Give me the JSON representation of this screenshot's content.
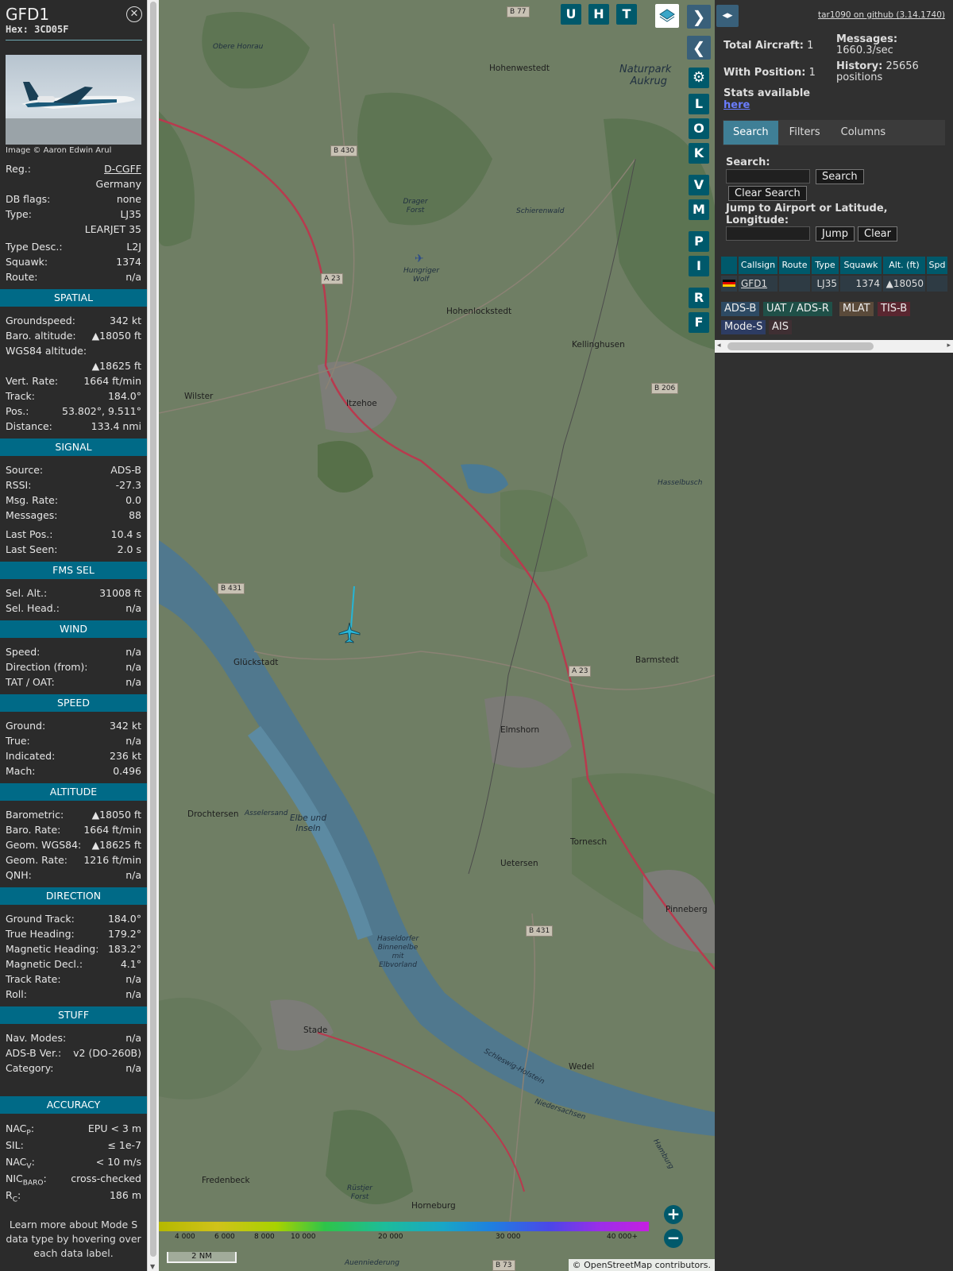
{
  "sidebar": {
    "callsign": "GFD1",
    "hex": "Hex: 3CD05F",
    "photo_credit": "Image © Aaron Edwin Arul",
    "info": [
      {
        "label": "Reg.:",
        "value": "D-CGFF"
      },
      {
        "label": "",
        "value": "Germany"
      },
      {
        "label": "DB flags:",
        "value": "none"
      },
      {
        "label": "Type:",
        "value": "LJ35"
      },
      {
        "label": "",
        "value": "LEARJET 35"
      }
    ],
    "info2": [
      {
        "label": "Type Desc.:",
        "value": "L2J"
      },
      {
        "label": "Squawk:",
        "value": "1374"
      },
      {
        "label": "Route:",
        "value": "n/a"
      }
    ],
    "spatial_title": "SPATIAL",
    "spatial": [
      {
        "label": "Groundspeed:",
        "value": "342 kt"
      },
      {
        "label": "Baro. altitude:",
        "value": "▲18050 ft"
      },
      {
        "label": "WGS84 altitude:",
        "value": ""
      },
      {
        "label": "",
        "value": "▲18625 ft"
      },
      {
        "label": "Vert. Rate:",
        "value": "1664 ft/min"
      },
      {
        "label": "Track:",
        "value": "184.0°"
      },
      {
        "label": "Pos.:",
        "value": "53.802°, 9.511°"
      },
      {
        "label": "Distance:",
        "value": "133.4 nmi"
      }
    ],
    "signal_title": "SIGNAL",
    "signal": [
      {
        "label": "Source:",
        "value": "ADS-B"
      },
      {
        "label": "RSSI:",
        "value": "-27.3"
      },
      {
        "label": "Msg. Rate:",
        "value": "0.0"
      },
      {
        "label": "Messages:",
        "value": "88"
      }
    ],
    "signal2": [
      {
        "label": "Last Pos.:",
        "value": "10.4 s"
      },
      {
        "label": "Last Seen:",
        "value": "2.0 s"
      }
    ],
    "fms_title": "FMS SEL",
    "fms": [
      {
        "label": "Sel. Alt.:",
        "value": "31008 ft"
      },
      {
        "label": "Sel. Head.:",
        "value": "n/a"
      }
    ],
    "wind_title": "WIND",
    "wind": [
      {
        "label": "Speed:",
        "value": "n/a"
      },
      {
        "label": "Direction (from):",
        "value": "n/a"
      },
      {
        "label": "TAT / OAT:",
        "value": "n/a"
      }
    ],
    "speed_title": "SPEED",
    "speed": [
      {
        "label": "Ground:",
        "value": "342 kt"
      },
      {
        "label": "True:",
        "value": "n/a"
      },
      {
        "label": "Indicated:",
        "value": "236 kt"
      },
      {
        "label": "Mach:",
        "value": "0.496"
      }
    ],
    "altitude_title": "ALTITUDE",
    "altitude": [
      {
        "label": "Barometric:",
        "value": "▲18050 ft"
      },
      {
        "label": "Baro. Rate:",
        "value": "1664 ft/min"
      },
      {
        "label": "Geom. WGS84:",
        "value": "▲18625 ft"
      },
      {
        "label": "Geom. Rate:",
        "value": "1216 ft/min"
      },
      {
        "label": "QNH:",
        "value": "n/a"
      }
    ],
    "direction_title": "DIRECTION",
    "direction": [
      {
        "label": "Ground Track:",
        "value": "184.0°"
      },
      {
        "label": "True Heading:",
        "value": "179.2°"
      },
      {
        "label": "Magnetic Heading:",
        "value": "183.2°"
      },
      {
        "label": "Magnetic Decl.:",
        "value": "4.1°"
      },
      {
        "label": "Track Rate:",
        "value": "n/a"
      },
      {
        "label": "Roll:",
        "value": "n/a"
      }
    ],
    "stuff_title": "STUFF",
    "stuff": [
      {
        "label": "Nav. Modes:",
        "value": "n/a"
      },
      {
        "label": "ADS-B Ver.:",
        "value": "v2 (DO-260B)"
      },
      {
        "label": "Category:",
        "value": "n/a"
      }
    ],
    "accuracy_title": "ACCURACY",
    "accuracy": [
      {
        "label": "NAC",
        "sub": "P",
        "value": "EPU < 3 m"
      },
      {
        "label": "SIL:",
        "sub": "",
        "value": "≤ 1e-7"
      },
      {
        "label": "NAC",
        "sub": "V",
        "value": "< 10 m/s"
      },
      {
        "label": "NIC",
        "sub": "BARO",
        "value": "cross-checked"
      },
      {
        "label": "R",
        "sub": "C",
        "value": "186 m"
      }
    ],
    "learn_more": "Learn more about Mode S data type by hovering over each data label."
  },
  "map": {
    "labels": [
      {
        "t": "Obere Honrau"
      },
      {
        "t": "Hohenwestedt"
      },
      {
        "t": "Naturpark Aukrug"
      },
      {
        "t": "Drager Forst"
      },
      {
        "t": "Schierenwald"
      },
      {
        "t": "Hungriger Wolf"
      },
      {
        "t": "Hohenlockstedt"
      },
      {
        "t": "Kellinghusen"
      },
      {
        "t": "Wilster"
      },
      {
        "t": "Itzehoe"
      },
      {
        "t": "Hasselbusch"
      },
      {
        "t": "Glückstadt"
      },
      {
        "t": "Barmstedt"
      },
      {
        "t": "Elmshorn"
      },
      {
        "t": "Drochtersen"
      },
      {
        "t": "Asselersand"
      },
      {
        "t": "Elbe und Inseln"
      },
      {
        "t": "Tornesch"
      },
      {
        "t": "Uetersen"
      },
      {
        "t": "Pinneberg"
      },
      {
        "t": "Haseldorfer Binnenelbe mit Elbvorland"
      },
      {
        "t": "Stade"
      },
      {
        "t": "Wedel"
      },
      {
        "t": "Schleswig-Holstein"
      },
      {
        "t": "Niedersachsen"
      },
      {
        "t": "Fredenbeck"
      },
      {
        "t": "Rüstjer Forst"
      },
      {
        "t": "Horneburg"
      },
      {
        "t": "Auenniederung"
      },
      {
        "t": "Hamburg"
      }
    ],
    "roads": [
      "B 77",
      "B 430",
      "A 23",
      "B 206",
      "B 431",
      "A 23",
      "B 431",
      "B 73"
    ],
    "controls_top": [
      "U",
      "H",
      "T"
    ],
    "controls_side": [
      "L",
      "O",
      "K",
      "V",
      "M",
      "P",
      "I",
      "R",
      "F"
    ],
    "color_ticks": [
      "4 000",
      "6 000",
      "8 000",
      "10 000",
      "20 000",
      "30 000",
      "40 000+"
    ],
    "scale": "2 NM",
    "attribution": "© OpenStreetMap contributors."
  },
  "panel": {
    "github": "tar1090 on github (3.14.1740)",
    "total_aircraft_label": "Total Aircraft:",
    "total_aircraft": "1",
    "with_position_label": "With Position:",
    "with_position": "1",
    "stats_label": "Stats available",
    "stats_link": "here",
    "messages_label": "Messages:",
    "messages_rate": "1660.3/sec",
    "history_label": "History:",
    "history_value": "25656",
    "history_unit": "positions",
    "tabs": [
      "Search",
      "Filters",
      "Columns"
    ],
    "search_label": "Search:",
    "search_button": "Search",
    "clear_search_button": "Clear Search",
    "jump_label": "Jump to Airport or Latitude, Longitude:",
    "jump_button": "Jump",
    "clear_button": "Clear",
    "columns": [
      "Callsign",
      "Route",
      "Type",
      "Squawk",
      "Alt. (ft)",
      "Spd"
    ],
    "row": {
      "callsign": "GFD1",
      "route": "",
      "type": "LJ35",
      "squawk": "1374",
      "alt": "▲18050",
      "spd": ""
    },
    "legend": [
      "ADS-B",
      "UAT / ADS-R",
      "MLAT",
      "TIS-B",
      "Mode-S",
      "AIS"
    ]
  }
}
